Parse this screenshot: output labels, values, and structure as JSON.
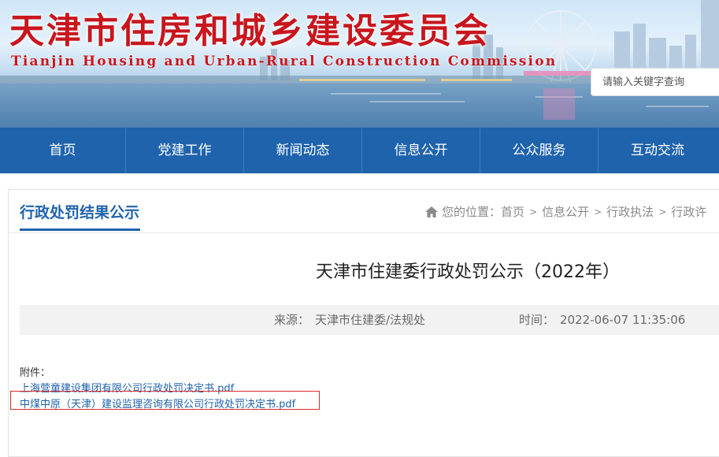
{
  "header": {
    "title_cn": "天津市住房和城乡建设委员会",
    "title_en": "Tianjin Housing and Urban-Rural Construction Commission",
    "search": {
      "placeholder": "请输入关键字查询"
    }
  },
  "nav": {
    "items": [
      "首页",
      "党建工作",
      "新闻动态",
      "信息公开",
      "公众服务",
      "互动交流"
    ]
  },
  "section": {
    "title": "行政处罚结果公示"
  },
  "breadcrumb": {
    "prefix": "您的位置：",
    "items": [
      "首页",
      "信息公开",
      "行政执法",
      "行政许"
    ],
    "separator": ">"
  },
  "article": {
    "title": "天津市住建委行政处罚公示（2022年）",
    "source_label": "来源：",
    "source": "天津市住建委/法规处",
    "time_label": "时间：",
    "time": "2022-06-07 11:35:06",
    "attachments_label": "附件：",
    "attachments": [
      "上海营童建设集团有限公司行政处罚决定书.pdf",
      "中煤中原（天津）建设监理咨询有限公司行政处罚决定书.pdf"
    ]
  },
  "colors": {
    "brand_blue": "#1f63ad",
    "title_red": "#c8161d",
    "highlight_red": "#d9282f"
  }
}
